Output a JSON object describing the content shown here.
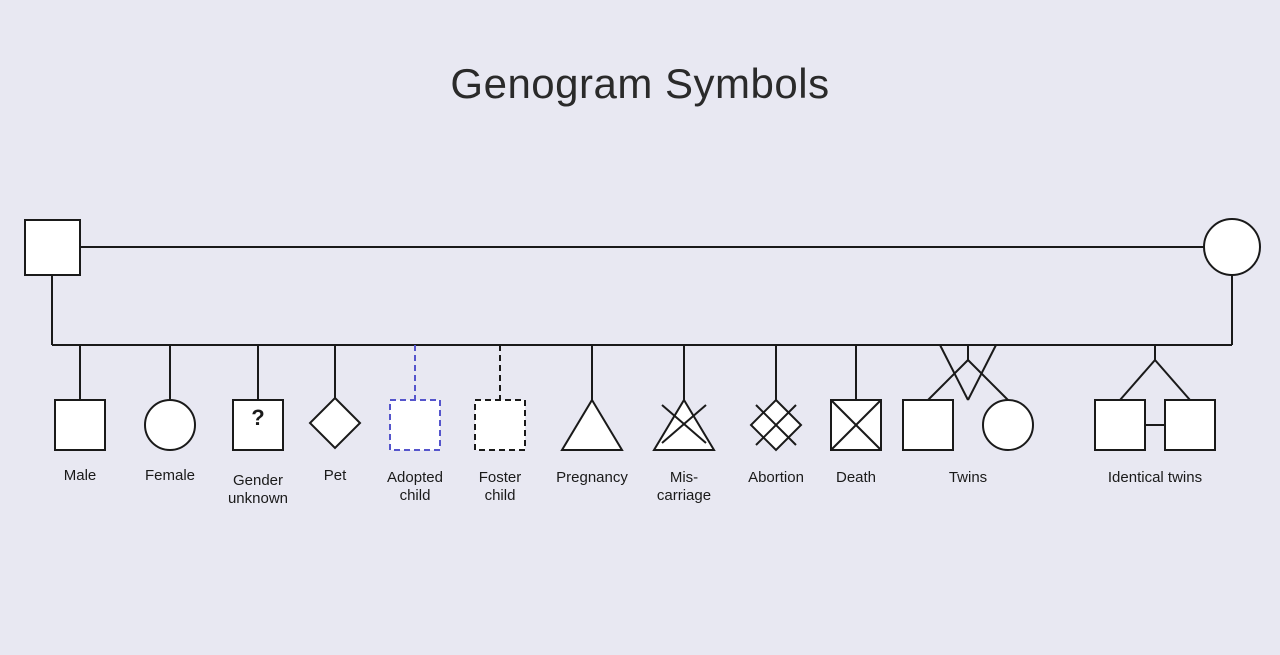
{
  "page": {
    "title": "Genogram Symbols",
    "background": "#e8e8f2"
  },
  "symbols": [
    {
      "id": "male",
      "label": "Male"
    },
    {
      "id": "female",
      "label": "Female"
    },
    {
      "id": "gender-unknown",
      "label": "Gender\nunknown"
    },
    {
      "id": "pet",
      "label": "Pet"
    },
    {
      "id": "adopted-child",
      "label": "Adopted\nchild"
    },
    {
      "id": "foster-child",
      "label": "Foster\nchild"
    },
    {
      "id": "pregnancy",
      "label": "Pregnancy"
    },
    {
      "id": "miscarriage",
      "label": "Mis-\ncarriage"
    },
    {
      "id": "abortion",
      "label": "Abortion"
    },
    {
      "id": "death",
      "label": "Death"
    },
    {
      "id": "twins",
      "label": "Twins"
    },
    {
      "id": "identical-twins",
      "label": "Identical twins"
    }
  ]
}
